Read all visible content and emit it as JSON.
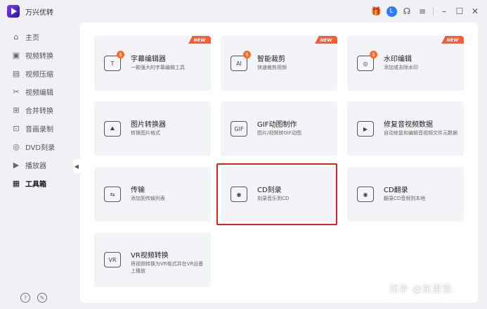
{
  "app": {
    "title": "万兴优转"
  },
  "titlebar": {
    "user_initial": "L",
    "icons": [
      "gift-icon",
      "user-avatar",
      "headset-icon",
      "menu-icon",
      "minimize-icon",
      "maximize-icon",
      "close-icon"
    ]
  },
  "sidebar": {
    "items": [
      {
        "label": "主页",
        "icon": "home-icon"
      },
      {
        "label": "视频转换",
        "icon": "video-convert-icon"
      },
      {
        "label": "视频压缩",
        "icon": "video-compress-icon"
      },
      {
        "label": "视频编辑",
        "icon": "scissors-icon"
      },
      {
        "label": "合并转换",
        "icon": "merge-icon"
      },
      {
        "label": "音画录制",
        "icon": "record-icon"
      },
      {
        "label": "DVD刻录",
        "icon": "dvd-icon"
      },
      {
        "label": "播放器",
        "icon": "player-icon"
      },
      {
        "label": "工具箱",
        "icon": "toolbox-icon",
        "active": true
      }
    ]
  },
  "tools": [
    {
      "title": "字幕编辑器",
      "desc": "一款强大的字幕编辑工具",
      "badge": "NEW",
      "icon": "subtitle-editor-icon",
      "glyph": "T",
      "paid": true
    },
    {
      "title": "智能裁剪",
      "desc": "快速裁剪视频",
      "badge": "NEW",
      "icon": "ai-crop-icon",
      "glyph": "AI",
      "paid": true
    },
    {
      "title": "水印编辑",
      "desc": "添加或去除水印",
      "badge": "NEW",
      "icon": "watermark-icon",
      "glyph": "◎",
      "paid": true
    },
    {
      "title": "图片转换器",
      "desc": "转换图片格式",
      "badge": "",
      "icon": "image-convert-icon",
      "glyph": "⛰",
      "paid": false
    },
    {
      "title": "GIF动图制作",
      "desc": "图片/视频转GIF动图",
      "badge": "",
      "icon": "gif-icon",
      "glyph": "GIF",
      "paid": false
    },
    {
      "title": "修复音视频数据",
      "desc": "自动修复和编辑音视频文件元数据",
      "badge": "",
      "icon": "repair-metadata-icon",
      "glyph": "▶",
      "paid": false
    },
    {
      "title": "传输",
      "desc": "添加到传输列表",
      "badge": "",
      "icon": "transfer-icon",
      "glyph": "⇆",
      "paid": false
    },
    {
      "title": "CD刻录",
      "desc": "刻录音乐到CD",
      "badge": "",
      "icon": "cd-burn-icon",
      "glyph": "◉",
      "paid": false
    },
    {
      "title": "CD翻录",
      "desc": "翻录CD音频到本地",
      "badge": "",
      "icon": "cd-rip-icon",
      "glyph": "◉",
      "paid": false
    },
    {
      "title": "VR视频转换",
      "desc": "将视频转换为VR格式并在VR设备上播放",
      "badge": "",
      "icon": "vr-icon",
      "glyph": "VR",
      "paid": false
    }
  ],
  "watermark": "知乎 @凯雷德",
  "colors": {
    "accent": "#2f7cf6",
    "new_badge": "#ff5b34",
    "highlight": "#e0201c"
  }
}
